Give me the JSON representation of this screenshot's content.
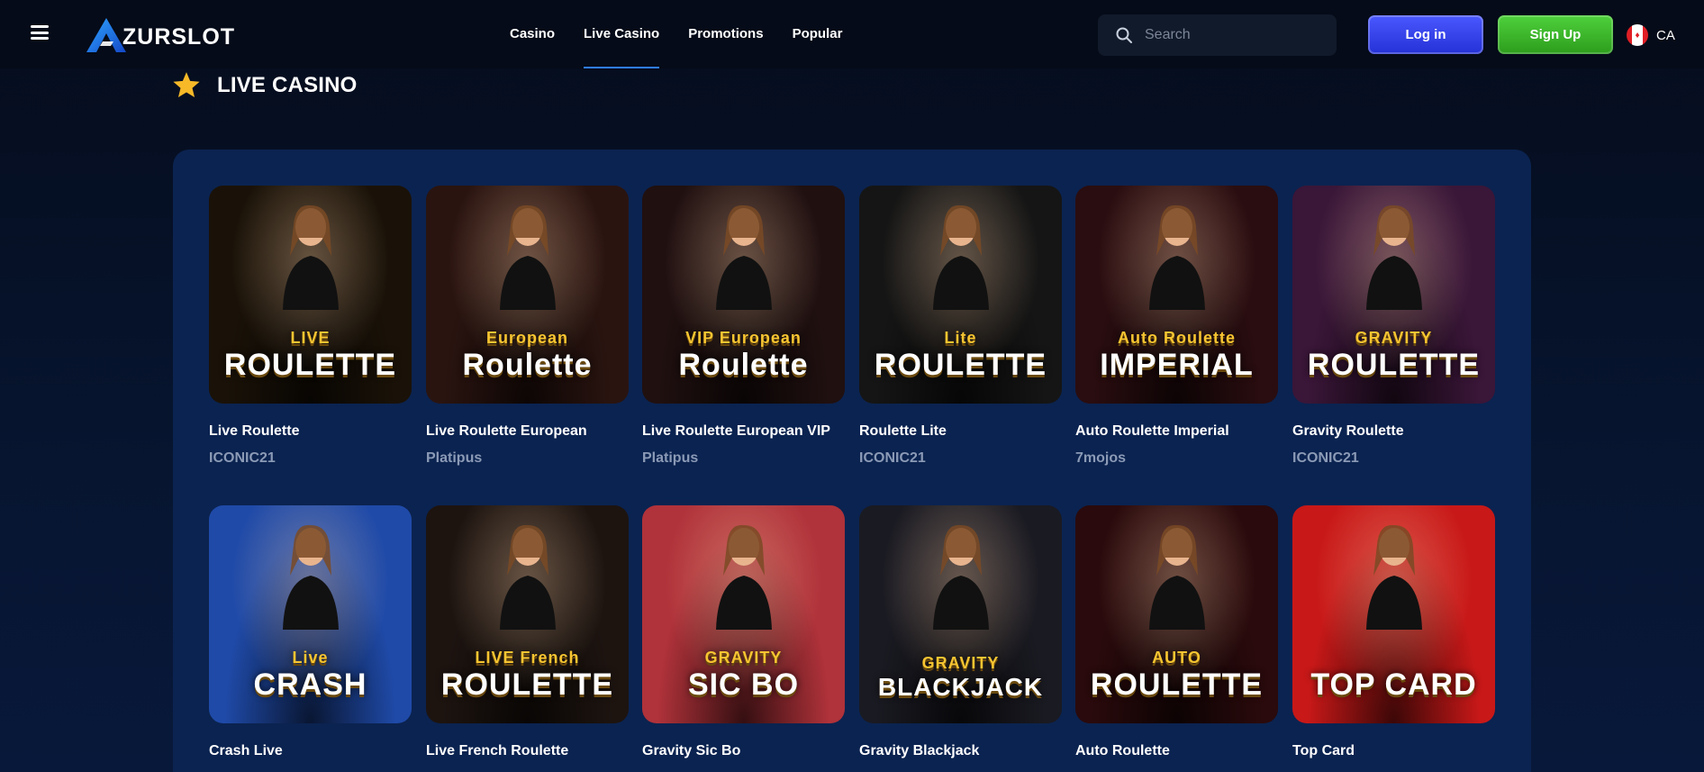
{
  "header": {
    "logo_text": "ZURSLOT",
    "nav": [
      {
        "label": "Casino",
        "active": false
      },
      {
        "label": "Live Casino",
        "active": true
      },
      {
        "label": "Promotions",
        "active": false
      },
      {
        "label": "Popular",
        "active": false
      }
    ],
    "search_placeholder": "Search",
    "login_label": "Log in",
    "signup_label": "Sign Up",
    "language": "CA"
  },
  "section": {
    "title": "LIVE CASINO",
    "icon": "star-icon"
  },
  "games": [
    {
      "name": "Live Roulette",
      "provider": "ICONIC21",
      "thumb_title": "ROULETTE",
      "thumb_sub": "LIVE",
      "bg": "#1a1208"
    },
    {
      "name": "Live Roulette European",
      "provider": "Platipus",
      "thumb_title": "Roulette",
      "thumb_sub": "European",
      "bg": "#2a1410"
    },
    {
      "name": "Live Roulette European VIP",
      "provider": "Platipus",
      "thumb_title": "Roulette",
      "thumb_sub": "VIP European",
      "bg": "#201010"
    },
    {
      "name": "Roulette Lite",
      "provider": "ICONIC21",
      "thumb_title": "ROULETTE",
      "thumb_sub": "Lite",
      "bg": "#151515"
    },
    {
      "name": "Auto Roulette Imperial",
      "provider": "7mojos",
      "thumb_title": "IMPERIAL",
      "thumb_sub": "Auto Roulette",
      "bg": "#2a0d10"
    },
    {
      "name": "Gravity Roulette",
      "provider": "ICONIC21",
      "thumb_title": "ROULETTE",
      "thumb_sub": "GRAVITY",
      "bg": "#3a1638"
    },
    {
      "name": "Crash Live",
      "provider": "",
      "thumb_title": "CRASH",
      "thumb_sub": "Live",
      "bg": "#1f4aa8"
    },
    {
      "name": "Live French Roulette",
      "provider": "",
      "thumb_title": "ROULETTE",
      "thumb_sub": "LIVE French",
      "bg": "#1d1410"
    },
    {
      "name": "Gravity Sic Bo",
      "provider": "",
      "thumb_title": "SIC BO",
      "thumb_sub": "GRAVITY",
      "bg": "#b0323a"
    },
    {
      "name": "Gravity Blackjack",
      "provider": "",
      "thumb_title": "BLACKJACK",
      "thumb_sub": "GRAVITY",
      "bg": "#1a1a22"
    },
    {
      "name": "Auto Roulette",
      "provider": "",
      "thumb_title": "ROULETTE",
      "thumb_sub": "AUTO",
      "bg": "#2a0a0c"
    },
    {
      "name": "Top Card",
      "provider": "",
      "thumb_title": "TOP CARD",
      "thumb_sub": "",
      "bg": "#c81818"
    }
  ]
}
